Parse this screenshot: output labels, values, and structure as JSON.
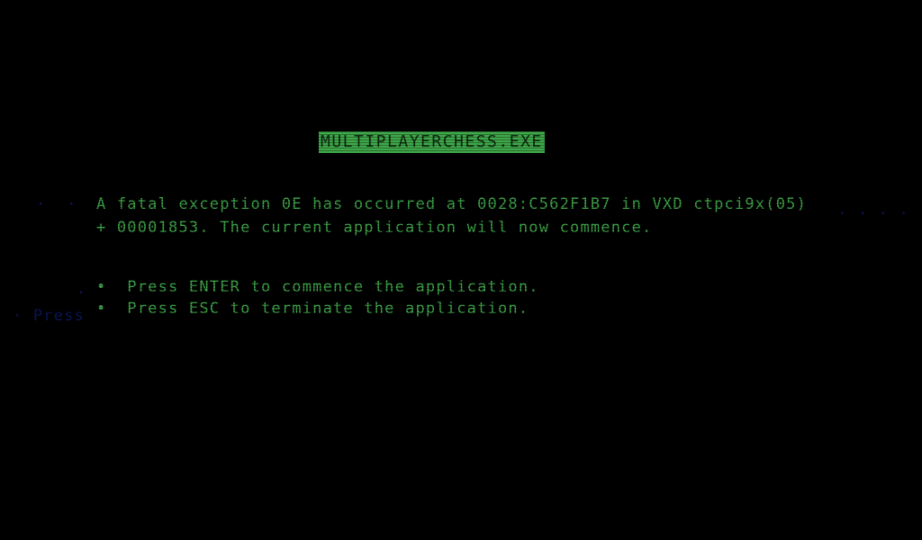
{
  "screen": {
    "title": "MULTIPLAYERCHESS.EXE",
    "error_line_1": "A fatal exception 0E has occurred at 0028:C562F1B7 in VXD ctpci9x(05)",
    "error_line_2": "+ 00001853. The current application will now commence.",
    "option_enter": "•  Press ENTER to commence the application.",
    "option_esc": "•  Press ESC to terminate the application."
  },
  "colors": {
    "background": "#000000",
    "text": "#3fa84a",
    "title_bg": "#3fa84a",
    "title_text": "#0d2a10"
  }
}
